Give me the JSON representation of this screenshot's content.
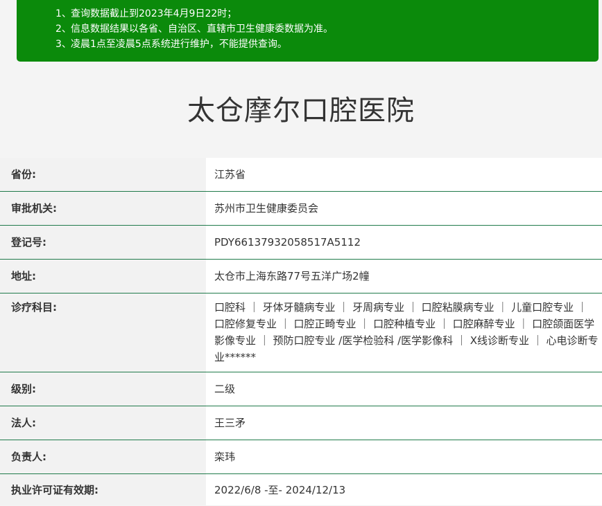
{
  "notice": {
    "lines": [
      {
        "num": "1、",
        "text": "查询数据截止到2023年4月9日22时；"
      },
      {
        "num": "2、",
        "text": "信息数据结果以各省、自治区、直辖市卫生健康委数据为准。"
      },
      {
        "num": "3、",
        "text": "凌晨1点至凌晨5点系统进行维护，不能提供查询。"
      }
    ]
  },
  "title": "太仓摩尔口腔医院",
  "fields": {
    "province": {
      "label": "省份:",
      "value": "江苏省"
    },
    "authority": {
      "label": "审批机关:",
      "value": "苏州市卫生健康委员会"
    },
    "registration": {
      "label": "登记号:",
      "value": "PDY66137932058517A5112"
    },
    "address": {
      "label": "地址:",
      "value": "太仓市上海东路77号五洋广场2幢"
    },
    "departments": {
      "label": "诊疗科目:",
      "value": "口腔科 ｜ 牙体牙髓病专业 ｜ 牙周病专业 ｜ 口腔粘膜病专业 ｜ 儿童口腔专业 ｜ 口腔修复专业 ｜ 口腔正畸专业 ｜ 口腔种植专业 ｜ 口腔麻醉专业 ｜ 口腔颌面医学影像专业 ｜ 预防口腔专业 /医学检验科 /医学影像科 ｜ X线诊断专业 ｜ 心电诊断专业******"
    },
    "level": {
      "label": "级别:",
      "value": "二级"
    },
    "legal_person": {
      "label": "法人:",
      "value": "王三矛"
    },
    "principal": {
      "label": "负责人:",
      "value": "栾玮"
    },
    "license_validity": {
      "label": "执业许可证有效期:",
      "value": "2022/6/8 -至- 2024/12/13"
    }
  }
}
